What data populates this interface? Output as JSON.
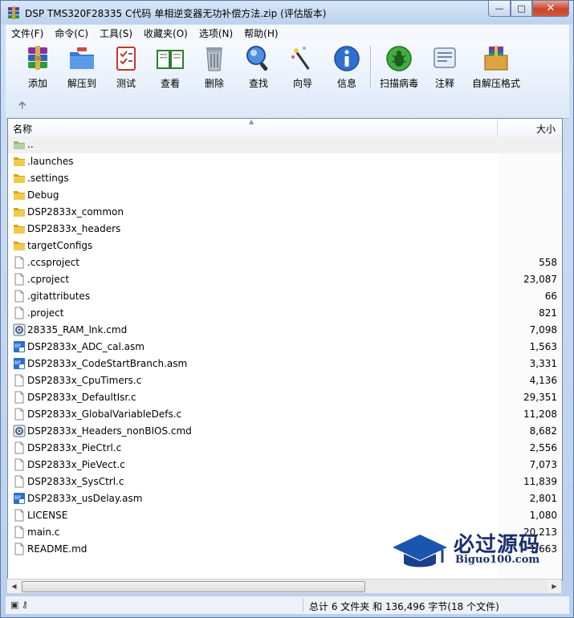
{
  "title": "DSP TMS320F28335 C代码 单相逆变器无功补偿方法.zip (评估版本)",
  "menu": [
    "文件(F)",
    "命令(C)",
    "工具(S)",
    "收藏夹(O)",
    "选项(N)",
    "帮助(H)"
  ],
  "toolbar": [
    {
      "label": "添加",
      "icon": "add-archive-icon"
    },
    {
      "label": "解压到",
      "icon": "extract-to-icon"
    },
    {
      "label": "测试",
      "icon": "test-icon"
    },
    {
      "label": "查看",
      "icon": "view-book-icon"
    },
    {
      "label": "删除",
      "icon": "trash-icon"
    },
    {
      "label": "查找",
      "icon": "find-icon"
    },
    {
      "label": "向导",
      "icon": "wizard-icon"
    },
    {
      "label": "信息",
      "icon": "info-icon"
    },
    {
      "label": "扫描病毒",
      "icon": "virus-scan-icon"
    },
    {
      "label": "注释",
      "icon": "comment-icon"
    },
    {
      "label": "自解压格式",
      "icon": "sfx-icon"
    }
  ],
  "columns": {
    "name": "名称",
    "size": "大小"
  },
  "files": [
    {
      "name": "..",
      "size": "",
      "type": "up"
    },
    {
      "name": ".launches",
      "size": "",
      "type": "folder"
    },
    {
      "name": ".settings",
      "size": "",
      "type": "folder"
    },
    {
      "name": "Debug",
      "size": "",
      "type": "folder"
    },
    {
      "name": "DSP2833x_common",
      "size": "",
      "type": "folder"
    },
    {
      "name": "DSP2833x_headers",
      "size": "",
      "type": "folder"
    },
    {
      "name": "targetConfigs",
      "size": "",
      "type": "folder"
    },
    {
      "name": ".ccsproject",
      "size": "558",
      "type": "file"
    },
    {
      "name": ".cproject",
      "size": "23,087",
      "type": "file"
    },
    {
      "name": ".gitattributes",
      "size": "66",
      "type": "file"
    },
    {
      "name": ".project",
      "size": "821",
      "type": "file"
    },
    {
      "name": "28335_RAM_lnk.cmd",
      "size": "7,098",
      "type": "cmd"
    },
    {
      "name": "DSP2833x_ADC_cal.asm",
      "size": "1,563",
      "type": "asm"
    },
    {
      "name": "DSP2833x_CodeStartBranch.asm",
      "size": "3,331",
      "type": "asm"
    },
    {
      "name": "DSP2833x_CpuTimers.c",
      "size": "4,136",
      "type": "c"
    },
    {
      "name": "DSP2833x_DefaultIsr.c",
      "size": "29,351",
      "type": "c"
    },
    {
      "name": "DSP2833x_GlobalVariableDefs.c",
      "size": "11,208",
      "type": "c"
    },
    {
      "name": "DSP2833x_Headers_nonBIOS.cmd",
      "size": "8,682",
      "type": "cmd"
    },
    {
      "name": "DSP2833x_PieCtrl.c",
      "size": "2,556",
      "type": "c"
    },
    {
      "name": "DSP2833x_PieVect.c",
      "size": "7,073",
      "type": "c"
    },
    {
      "name": "DSP2833x_SysCtrl.c",
      "size": "11,839",
      "type": "c"
    },
    {
      "name": "DSP2833x_usDelay.asm",
      "size": "2,801",
      "type": "asm"
    },
    {
      "name": "LICENSE",
      "size": "1,080",
      "type": "file"
    },
    {
      "name": "main.c",
      "size": "20,213",
      "type": "c"
    },
    {
      "name": "README.md",
      "size": "1,663",
      "type": "file"
    }
  ],
  "status": "总计 6 文件夹 和 136,496 字节(18 个文件)",
  "watermark": {
    "cn": "必过源码",
    "en": "Biguo100.com"
  }
}
